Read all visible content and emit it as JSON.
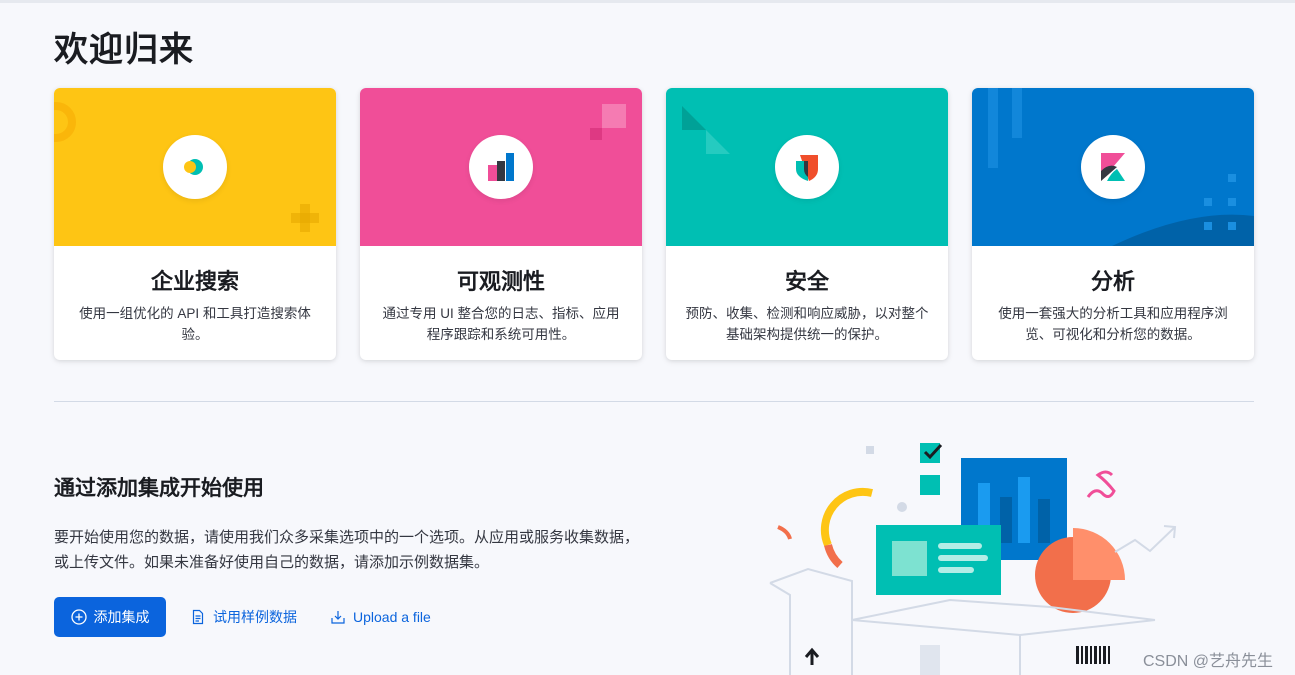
{
  "page": {
    "title": "欢迎归来"
  },
  "cards": [
    {
      "title": "企业搜索",
      "description": "使用一组优化的 API 和工具打造搜索体验。",
      "color": "#fec514",
      "icon": "enterprise-search-icon"
    },
    {
      "title": "可观测性",
      "description": "通过专用 UI 整合您的日志、指标、应用程序跟踪和系统可用性。",
      "color": "#f04e98",
      "icon": "observability-icon"
    },
    {
      "title": "安全",
      "description": "预防、收集、检测和响应威胁，以对整个基础架构提供统一的保护。",
      "color": "#00bfb3",
      "icon": "security-icon"
    },
    {
      "title": "分析",
      "description": "使用一套强大的分析工具和应用程序浏览、可视化和分析您的数据。",
      "color": "#0077cc",
      "icon": "kibana-icon"
    }
  ],
  "integrations": {
    "title": "通过添加集成开始使用",
    "description": "要开始使用您的数据，请使用我们众多采集选项中的一个选项。从应用或服务收集数据，或上传文件。如果未准备好使用自己的数据，请添加示例数据集。",
    "add_button": "添加集成",
    "sample_link": "试用样例数据",
    "upload_link": "Upload a file"
  },
  "watermark": "CSDN @艺舟先生",
  "colors": {
    "accent": "#0b64dd",
    "yellow": "#fec514",
    "pink": "#f04e98",
    "teal": "#00bfb3",
    "blue": "#0077cc"
  }
}
